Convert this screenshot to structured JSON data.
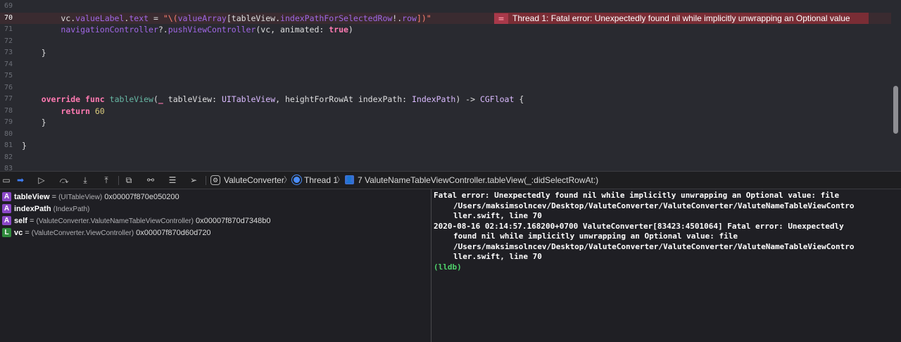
{
  "editor": {
    "lines": [
      {
        "num": "69",
        "tokens": [],
        "highlight": false
      },
      {
        "num": "70",
        "highlight": true,
        "tokens": [
          {
            "t": "        vc.",
            "c": "plain"
          },
          {
            "t": "valueLabel",
            "c": "prop"
          },
          {
            "t": ".",
            "c": "plain"
          },
          {
            "t": "text",
            "c": "prop"
          },
          {
            "t": " = ",
            "c": "plain"
          },
          {
            "t": "\"\\(",
            "c": "str"
          },
          {
            "t": "valueArray",
            "c": "prop"
          },
          {
            "t": "[tableView.",
            "c": "plain"
          },
          {
            "t": "indexPathForSelectedRow",
            "c": "prop"
          },
          {
            "t": "!.",
            "c": "plain"
          },
          {
            "t": "row",
            "c": "prop"
          },
          {
            "t": "])\"",
            "c": "str"
          }
        ]
      },
      {
        "num": "71",
        "highlight": false,
        "tokens": [
          {
            "t": "        ",
            "c": "plain"
          },
          {
            "t": "navigationController",
            "c": "prop"
          },
          {
            "t": "?.",
            "c": "plain"
          },
          {
            "t": "pushViewController",
            "c": "prop"
          },
          {
            "t": "(vc, animated: ",
            "c": "plain"
          },
          {
            "t": "true",
            "c": "kw"
          },
          {
            "t": ")",
            "c": "plain"
          }
        ]
      },
      {
        "num": "72",
        "tokens": [],
        "highlight": false
      },
      {
        "num": "73",
        "highlight": false,
        "tokens": [
          {
            "t": "    }",
            "c": "plain"
          }
        ]
      },
      {
        "num": "74",
        "tokens": [],
        "highlight": false
      },
      {
        "num": "75",
        "tokens": [],
        "highlight": false
      },
      {
        "num": "76",
        "tokens": [],
        "highlight": false
      },
      {
        "num": "77",
        "highlight": false,
        "tokens": [
          {
            "t": "    ",
            "c": "plain"
          },
          {
            "t": "override",
            "c": "kw"
          },
          {
            "t": " ",
            "c": "plain"
          },
          {
            "t": "func",
            "c": "kw"
          },
          {
            "t": " ",
            "c": "plain"
          },
          {
            "t": "tableView",
            "c": "fn"
          },
          {
            "t": "(",
            "c": "plain"
          },
          {
            "t": "_",
            "c": "kw"
          },
          {
            "t": " tableView: ",
            "c": "plain"
          },
          {
            "t": "UITableView",
            "c": "type"
          },
          {
            "t": ", heightForRowAt indexPath: ",
            "c": "plain"
          },
          {
            "t": "IndexPath",
            "c": "type"
          },
          {
            "t": ") -> ",
            "c": "plain"
          },
          {
            "t": "CGFloat",
            "c": "type"
          },
          {
            "t": " {",
            "c": "plain"
          }
        ]
      },
      {
        "num": "78",
        "highlight": false,
        "tokens": [
          {
            "t": "        ",
            "c": "plain"
          },
          {
            "t": "return",
            "c": "kw"
          },
          {
            "t": " ",
            "c": "plain"
          },
          {
            "t": "60",
            "c": "num"
          }
        ]
      },
      {
        "num": "79",
        "highlight": false,
        "tokens": [
          {
            "t": "    }",
            "c": "plain"
          }
        ]
      },
      {
        "num": "80",
        "tokens": [],
        "highlight": false
      },
      {
        "num": "81",
        "highlight": false,
        "tokens": [
          {
            "t": "}",
            "c": "plain"
          }
        ]
      },
      {
        "num": "82",
        "tokens": [],
        "highlight": false
      },
      {
        "num": "83",
        "tokens": [],
        "highlight": false
      }
    ],
    "error_message": "Thread 1: Fatal error: Unexpectedly found nil while implicitly unwrapping an Optional value",
    "error_icon": "error-marker-icon"
  },
  "debug_bar": {
    "app_name": "ValuteConverter",
    "thread": "Thread 1",
    "frame": "7 ValuteNameTableViewController.tableView(_:didSelectRowAt:)",
    "buttons": [
      "hide-debug-area-icon",
      "breakpoints-icon",
      "continue-icon",
      "step-over-icon",
      "step-into-icon",
      "step-out-icon",
      "view-debugger-icon",
      "memory-graph-icon",
      "environment-overrides-icon",
      "location-icon"
    ]
  },
  "variables": [
    {
      "badge": "A",
      "kind": "argument",
      "name": "tableView",
      "type": "(UITableView)",
      "value": "0x00007f870e050200"
    },
    {
      "badge": "A",
      "kind": "argument",
      "name": "indexPath",
      "type": "(IndexPath)",
      "value": ""
    },
    {
      "badge": "A",
      "kind": "argument",
      "name": "self",
      "type": "(ValuteConverter.ValuteNameTableViewController)",
      "value": "0x00007f870d7348b0"
    },
    {
      "badge": "L",
      "kind": "local",
      "name": "vc",
      "type": "(ValuteConverter.ViewController)",
      "value": "0x00007f870d60d720"
    }
  ],
  "console": {
    "lines": [
      {
        "text": "Fatal error: Unexpectedly found nil while implicitly unwrapping an Optional value: file",
        "indent": false
      },
      {
        "text": "/Users/maksimsolncev/Desktop/ValuteConverter/ValuteConverter/ValuteNameTableViewContro",
        "indent": true
      },
      {
        "text": "ller.swift, line 70",
        "indent": true
      },
      {
        "text": "2020-08-16 02:14:57.168200+0700 ValuteConverter[83423:4501064] Fatal error: Unexpectedly",
        "indent": false
      },
      {
        "text": "found nil while implicitly unwrapping an Optional value: file",
        "indent": true
      },
      {
        "text": "/Users/maksimsolncev/Desktop/ValuteConverter/ValuteConverter/ValuteNameTableViewContro",
        "indent": true
      },
      {
        "text": "ller.swift, line 70",
        "indent": true
      }
    ],
    "prompt": "(lldb)"
  }
}
